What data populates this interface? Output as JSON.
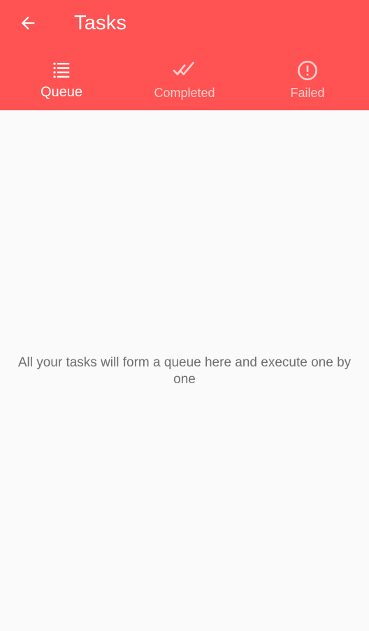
{
  "header": {
    "title": "Tasks",
    "back_icon": "arrow-left-icon"
  },
  "tabs": [
    {
      "label": "Queue",
      "icon": "list-icon",
      "active": true
    },
    {
      "label": "Completed",
      "icon": "double-check-icon",
      "active": false
    },
    {
      "label": "Failed",
      "icon": "alert-circle-icon",
      "active": false
    }
  ],
  "content": {
    "empty_message": "All your tasks will form a queue here and execute one by one"
  },
  "colors": {
    "header_bg": "#ff5252",
    "page_bg": "#fafafa",
    "text_secondary": "#6d6d6d"
  }
}
